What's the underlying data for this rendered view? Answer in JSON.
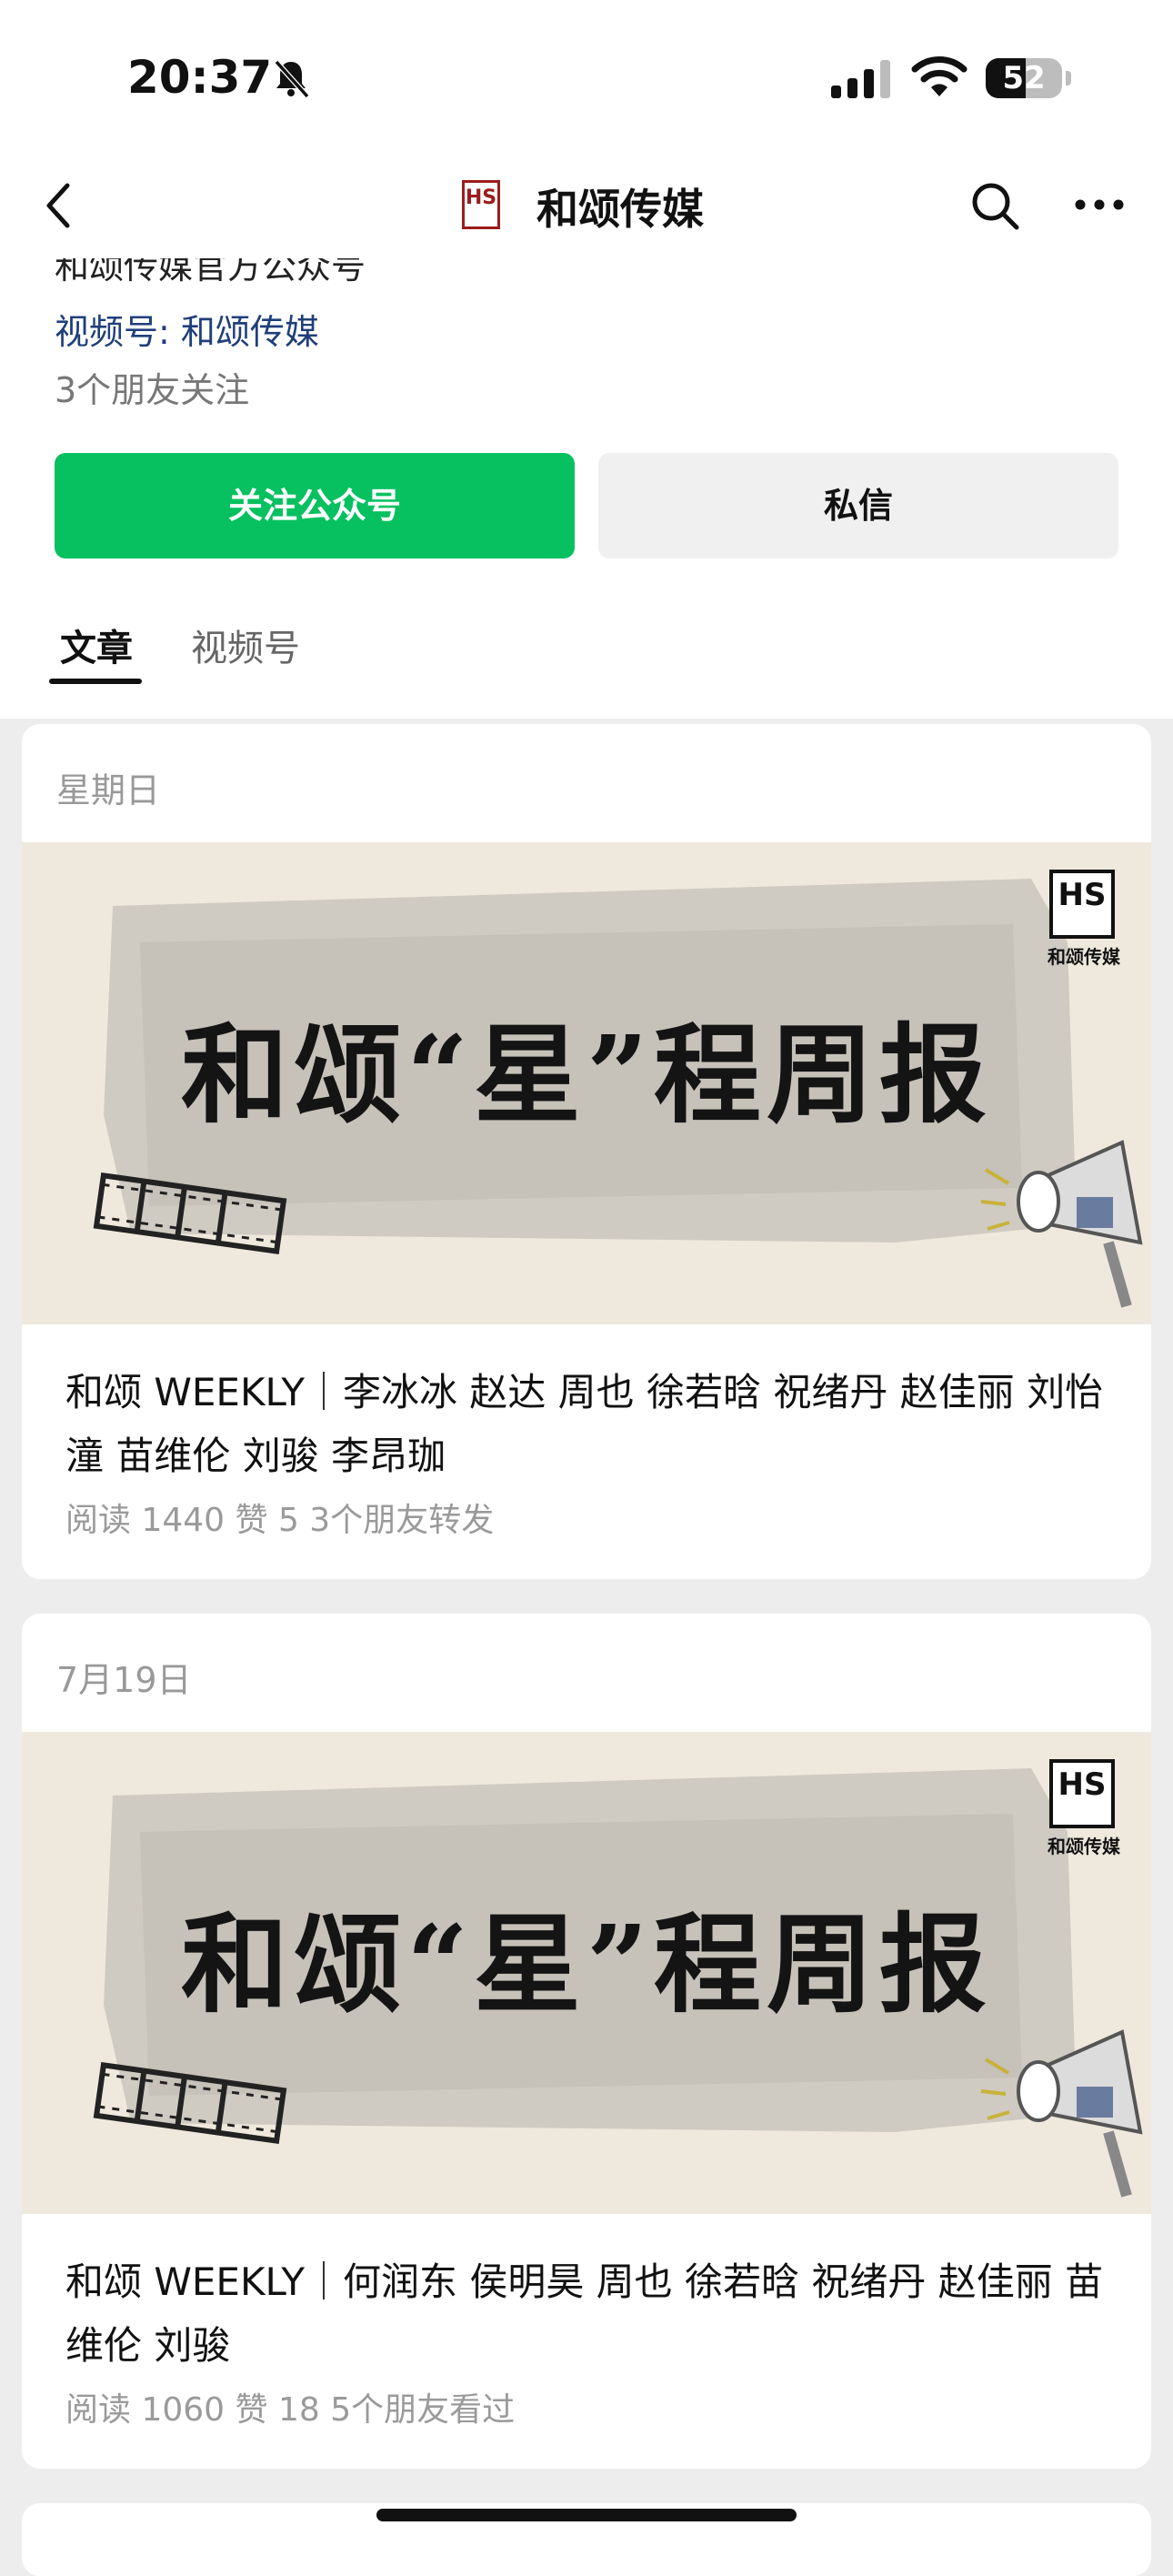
{
  "status_bar": {
    "time": "20:37",
    "battery_level": "52",
    "battery_fraction": 0.52,
    "icons": [
      "bell-muted-icon",
      "signal-icon",
      "wifi-icon",
      "battery-icon"
    ]
  },
  "nav": {
    "title": "和颂传媒",
    "logo_text": "HS",
    "icons": [
      "back-icon",
      "search-icon",
      "more-icon"
    ]
  },
  "profile": {
    "intro": "和颂传媒官方公众号",
    "channel": "视频号: 和颂传媒",
    "friends_following": "3个朋友关注"
  },
  "buttons": {
    "follow": "关注公众号",
    "message": "私信"
  },
  "tabs": [
    {
      "label": "文章",
      "active": true
    },
    {
      "label": "视频号",
      "active": false
    }
  ],
  "articles": [
    {
      "date": "星期日",
      "cover_title": "和颂“星”程周报",
      "cover_logo_mark": "HS",
      "cover_logo_name": "和颂传媒",
      "title": "和颂 WEEKLY｜李冰冰 赵达 周也 徐若晗 祝绪丹 赵佳丽 刘怡潼 苗维伦 刘骏 李昂珈",
      "stats": "阅读 1440   赞 5   3个朋友转发"
    },
    {
      "date": "7月19日",
      "cover_title": "和颂“星”程周报",
      "cover_logo_mark": "HS",
      "cover_logo_name": "和颂传媒",
      "title": "和颂 WEEKLY｜何润东 侯明昊 周也 徐若晗 祝绪丹 赵佳丽 苗维伦 刘骏",
      "stats": "阅读 1060   赞 18   5个朋友看过"
    }
  ],
  "colors": {
    "accent_green": "#07c160",
    "link_blue": "#1f3f7a",
    "logo_red": "#9b1c1c",
    "background": "#ededed"
  }
}
